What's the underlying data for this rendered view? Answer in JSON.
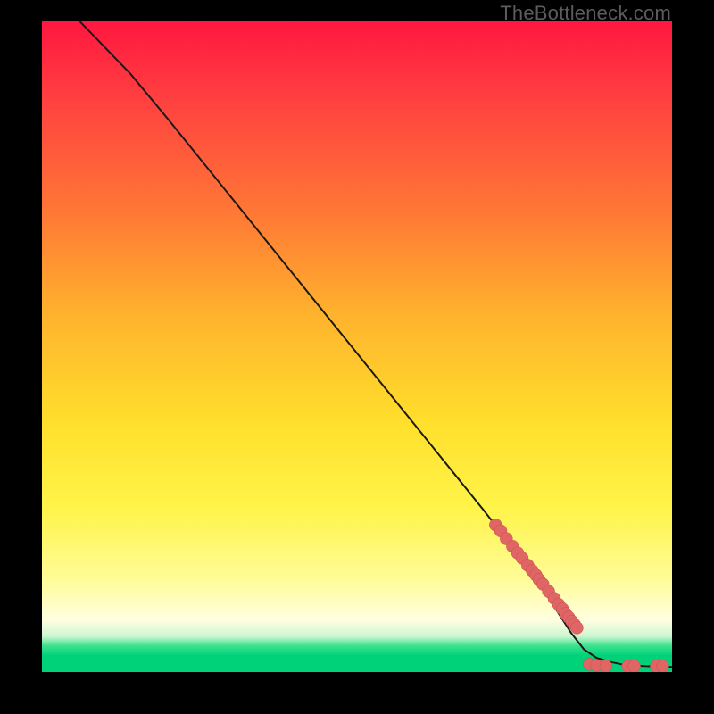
{
  "meta": {
    "watermark_text": "TheBottleneck.com"
  },
  "colors": {
    "bg_black": "#000000",
    "dot_fill": "#e06666",
    "curve_stroke": "#1a1a1a",
    "gradient_stops": [
      "#ff173f",
      "#ff4040",
      "#ff7a35",
      "#ffb22d",
      "#ffe02c",
      "#fff44a",
      "#fffc9a",
      "#fffee0",
      "#cdf6d2",
      "#39e28b",
      "#00d27a"
    ]
  },
  "chart_data": {
    "type": "line",
    "title": "",
    "xlabel": "",
    "ylabel": "",
    "xlim": [
      0,
      100
    ],
    "ylim": [
      0,
      100
    ],
    "grid": false,
    "note": "Axes are unlabeled in the source image; values are normalized 0–100 estimates read from the plot geometry.",
    "series": [
      {
        "name": "curve",
        "type": "line",
        "x": [
          6,
          8,
          10,
          14,
          20,
          30,
          40,
          50,
          60,
          70,
          78,
          84,
          86,
          88,
          90,
          92,
          94,
          96,
          98,
          100
        ],
        "y": [
          100,
          98,
          96,
          92,
          85,
          73,
          61,
          49,
          37,
          25,
          15,
          6,
          3.5,
          2.2,
          1.6,
          1.2,
          1.0,
          0.9,
          0.85,
          0.8
        ]
      },
      {
        "name": "points",
        "type": "scatter",
        "x": [
          72.0,
          72.8,
          73.7,
          74.7,
          75.5,
          76.2,
          77.1,
          77.8,
          78.4,
          78.9,
          79.5,
          80.4,
          81.3,
          82.0,
          82.6,
          83.1,
          83.6,
          84.1,
          84.5,
          84.9,
          86.9,
          88.0,
          89.5,
          93.0,
          94.0,
          97.5,
          98.5
        ],
        "y": [
          22.6,
          21.7,
          20.5,
          19.3,
          18.3,
          17.5,
          16.4,
          15.6,
          14.9,
          14.2,
          13.5,
          12.4,
          11.3,
          10.4,
          9.7,
          9.0,
          8.4,
          7.8,
          7.3,
          6.8,
          1.2,
          1.0,
          0.9,
          0.9,
          0.9,
          0.9,
          0.9
        ]
      }
    ]
  }
}
